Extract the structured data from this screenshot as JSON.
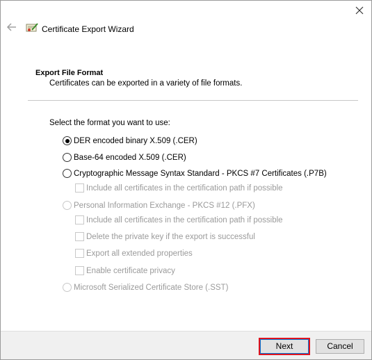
{
  "window": {
    "title": "Certificate Export Wizard"
  },
  "header": {
    "section_title": "Export File Format",
    "section_desc": "Certificates can be exported in a variety of file formats."
  },
  "form": {
    "prompt": "Select the format you want to use:",
    "options": [
      {
        "label": "DER encoded binary X.509 (.CER)",
        "type": "radio",
        "checked": true,
        "enabled": true
      },
      {
        "label": "Base-64 encoded X.509 (.CER)",
        "type": "radio",
        "checked": false,
        "enabled": true
      },
      {
        "label": "Cryptographic Message Syntax Standard - PKCS #7 Certificates (.P7B)",
        "type": "radio",
        "checked": false,
        "enabled": true
      },
      {
        "label": "Include all certificates in the certification path if possible",
        "type": "checkbox",
        "checked": false,
        "enabled": false
      },
      {
        "label": "Personal Information Exchange - PKCS #12 (.PFX)",
        "type": "radio",
        "checked": false,
        "enabled": false
      },
      {
        "label": "Include all certificates in the certification path if possible",
        "type": "checkbox",
        "checked": false,
        "enabled": false
      },
      {
        "label": "Delete the private key if the export is successful",
        "type": "checkbox",
        "checked": false,
        "enabled": false
      },
      {
        "label": "Export all extended properties",
        "type": "checkbox",
        "checked": false,
        "enabled": false
      },
      {
        "label": "Enable certificate privacy",
        "type": "checkbox",
        "checked": false,
        "enabled": false
      },
      {
        "label": "Microsoft Serialized Certificate Store (.SST)",
        "type": "radio",
        "checked": false,
        "enabled": false
      }
    ]
  },
  "footer": {
    "next_label": "Next",
    "cancel_label": "Cancel"
  },
  "colors": {
    "highlight": "#e0141e",
    "disabled_text": "#9a9a9a",
    "footer_bg": "#f0f0f0"
  }
}
